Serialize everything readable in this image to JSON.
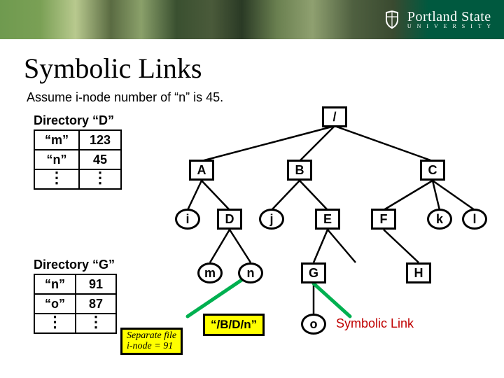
{
  "brand": {
    "name": "Portland State",
    "sub": "U N I V E R S I T Y"
  },
  "title": "Symbolic Links",
  "assume": "Assume i-node number of “n” is 45.",
  "dirD": {
    "label": "Directory “D”",
    "rows": [
      {
        "name": "“m”",
        "inode": "123"
      },
      {
        "name": "“n”",
        "inode": "45"
      }
    ]
  },
  "dirG": {
    "label": "Directory “G”",
    "rows": [
      {
        "name": "“n”",
        "inode": "91"
      },
      {
        "name": "“o”",
        "inode": "87"
      }
    ]
  },
  "separateFile": {
    "line1": "Separate file",
    "line2": "i-node = 91"
  },
  "symlinkContent": "“/B/D/n”",
  "symLabel": "Symbolic Link",
  "tree": {
    "root": "/",
    "A": "A",
    "B": "B",
    "C": "C",
    "i": "i",
    "D": "D",
    "j": "j",
    "E": "E",
    "F": "F",
    "k": "k",
    "l": "l",
    "m": "m",
    "n": "n",
    "G": "G",
    "H": "H",
    "o": "o"
  }
}
